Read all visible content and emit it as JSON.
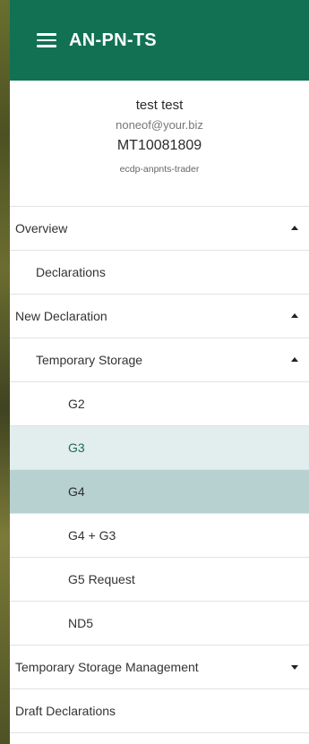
{
  "header": {
    "title": "AN-PN-TS",
    "menu_icon": "hamburger-menu-icon",
    "background_color": "#127153"
  },
  "profile": {
    "name": "test test",
    "email": "noneof@your.biz",
    "id": "MT10081809",
    "role": "ecdp-anpnts-trader"
  },
  "nav": {
    "overview": {
      "label": "Overview",
      "expanded": true
    },
    "declarations": {
      "label": "Declarations"
    },
    "new_declaration": {
      "label": "New Declaration",
      "expanded": true
    },
    "temporary_storage": {
      "label": "Temporary Storage",
      "expanded": true
    },
    "g2": {
      "label": "G2"
    },
    "g3": {
      "label": "G3",
      "state": "hover"
    },
    "g4": {
      "label": "G4",
      "state": "selected"
    },
    "g4_g3": {
      "label": "G4 + G3"
    },
    "g5_request": {
      "label": "G5 Request"
    },
    "nd5": {
      "label": "ND5"
    },
    "ts_management": {
      "label": "Temporary Storage Management",
      "expanded": false
    },
    "draft_declarations": {
      "label": "Draft Declarations"
    }
  },
  "colors": {
    "hover_bg": "#e2eeed",
    "selected_bg": "#b7d1d0"
  }
}
